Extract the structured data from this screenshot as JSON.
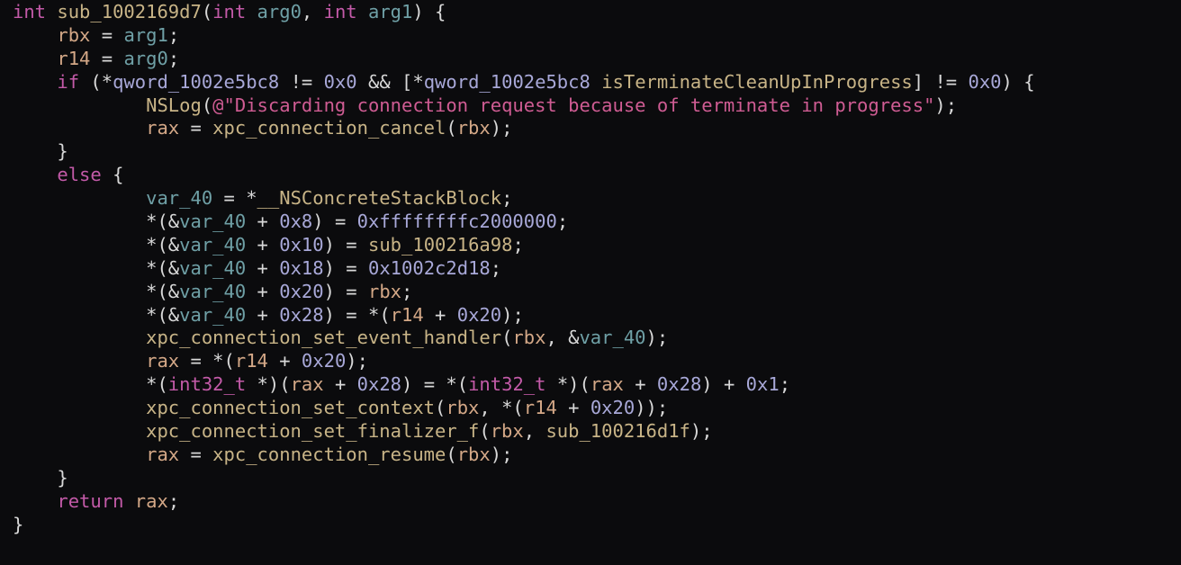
{
  "colors": {
    "background": "#0b0b0d",
    "keyword": "#c35aa8",
    "function": "#c8b487",
    "variable": "#6fa0a6",
    "register": "#d4a887",
    "number": "#a8a8d8",
    "string": "#cf5c93",
    "plain": "#d8d8d8"
  },
  "code_lines": [
    [
      [
        "keyword",
        "int"
      ],
      [
        "plain",
        " "
      ],
      [
        "function",
        "sub_1002169d7"
      ],
      [
        "plain",
        "("
      ],
      [
        "keyword",
        "int"
      ],
      [
        "plain",
        " "
      ],
      [
        "variable",
        "arg0"
      ],
      [
        "plain",
        ", "
      ],
      [
        "keyword",
        "int"
      ],
      [
        "plain",
        " "
      ],
      [
        "variable",
        "arg1"
      ],
      [
        "plain",
        ") {"
      ]
    ],
    [
      [
        "plain",
        "    "
      ],
      [
        "register",
        "rbx"
      ],
      [
        "plain",
        " = "
      ],
      [
        "variable",
        "arg1"
      ],
      [
        "plain",
        ";"
      ]
    ],
    [
      [
        "plain",
        "    "
      ],
      [
        "register",
        "r14"
      ],
      [
        "plain",
        " = "
      ],
      [
        "variable",
        "arg0"
      ],
      [
        "plain",
        ";"
      ]
    ],
    [
      [
        "plain",
        "    "
      ],
      [
        "keyword",
        "if"
      ],
      [
        "plain",
        " (*"
      ],
      [
        "number",
        "qword_1002e5bc8"
      ],
      [
        "plain",
        " != "
      ],
      [
        "number",
        "0x0"
      ],
      [
        "plain",
        " && [*"
      ],
      [
        "number",
        "qword_1002e5bc8"
      ],
      [
        "plain",
        " "
      ],
      [
        "function",
        "isTerminateCleanUpInProgress"
      ],
      [
        "plain",
        "] != "
      ],
      [
        "number",
        "0x0"
      ],
      [
        "plain",
        ") {"
      ]
    ],
    [
      [
        "plain",
        "            "
      ],
      [
        "function",
        "NSLog"
      ],
      [
        "plain",
        "("
      ],
      [
        "string",
        "@\"Discarding connection request because of terminate in progress\""
      ],
      [
        "plain",
        ");"
      ]
    ],
    [
      [
        "plain",
        "            "
      ],
      [
        "register",
        "rax"
      ],
      [
        "plain",
        " = "
      ],
      [
        "function",
        "xpc_connection_cancel"
      ],
      [
        "plain",
        "("
      ],
      [
        "register",
        "rbx"
      ],
      [
        "plain",
        ");"
      ]
    ],
    [
      [
        "plain",
        "    }"
      ]
    ],
    [
      [
        "plain",
        "    "
      ],
      [
        "keyword",
        "else"
      ],
      [
        "plain",
        " {"
      ]
    ],
    [
      [
        "plain",
        "            "
      ],
      [
        "variable",
        "var_40"
      ],
      [
        "plain",
        " = *"
      ],
      [
        "function",
        "__NSConcreteStackBlock"
      ],
      [
        "plain",
        ";"
      ]
    ],
    [
      [
        "plain",
        "            *(&"
      ],
      [
        "variable",
        "var_40"
      ],
      [
        "plain",
        " + "
      ],
      [
        "number",
        "0x8"
      ],
      [
        "plain",
        ") = "
      ],
      [
        "number",
        "0xffffffffc2000000"
      ],
      [
        "plain",
        ";"
      ]
    ],
    [
      [
        "plain",
        "            *(&"
      ],
      [
        "variable",
        "var_40"
      ],
      [
        "plain",
        " + "
      ],
      [
        "number",
        "0x10"
      ],
      [
        "plain",
        ") = "
      ],
      [
        "function",
        "sub_100216a98"
      ],
      [
        "plain",
        ";"
      ]
    ],
    [
      [
        "plain",
        "            *(&"
      ],
      [
        "variable",
        "var_40"
      ],
      [
        "plain",
        " + "
      ],
      [
        "number",
        "0x18"
      ],
      [
        "plain",
        ") = "
      ],
      [
        "number",
        "0x1002c2d18"
      ],
      [
        "plain",
        ";"
      ]
    ],
    [
      [
        "plain",
        "            *(&"
      ],
      [
        "variable",
        "var_40"
      ],
      [
        "plain",
        " + "
      ],
      [
        "number",
        "0x20"
      ],
      [
        "plain",
        ") = "
      ],
      [
        "register",
        "rbx"
      ],
      [
        "plain",
        ";"
      ]
    ],
    [
      [
        "plain",
        "            *(&"
      ],
      [
        "variable",
        "var_40"
      ],
      [
        "plain",
        " + "
      ],
      [
        "number",
        "0x28"
      ],
      [
        "plain",
        ") = *("
      ],
      [
        "register",
        "r14"
      ],
      [
        "plain",
        " + "
      ],
      [
        "number",
        "0x20"
      ],
      [
        "plain",
        ");"
      ]
    ],
    [
      [
        "plain",
        "            "
      ],
      [
        "function",
        "xpc_connection_set_event_handler"
      ],
      [
        "plain",
        "("
      ],
      [
        "register",
        "rbx"
      ],
      [
        "plain",
        ", &"
      ],
      [
        "variable",
        "var_40"
      ],
      [
        "plain",
        ");"
      ]
    ],
    [
      [
        "plain",
        "            "
      ],
      [
        "register",
        "rax"
      ],
      [
        "plain",
        " = *("
      ],
      [
        "register",
        "r14"
      ],
      [
        "plain",
        " + "
      ],
      [
        "number",
        "0x20"
      ],
      [
        "plain",
        ");"
      ]
    ],
    [
      [
        "plain",
        "            *("
      ],
      [
        "keyword",
        "int32_t"
      ],
      [
        "plain",
        " *)("
      ],
      [
        "register",
        "rax"
      ],
      [
        "plain",
        " + "
      ],
      [
        "number",
        "0x28"
      ],
      [
        "plain",
        ") = *("
      ],
      [
        "keyword",
        "int32_t"
      ],
      [
        "plain",
        " *)("
      ],
      [
        "register",
        "rax"
      ],
      [
        "plain",
        " + "
      ],
      [
        "number",
        "0x28"
      ],
      [
        "plain",
        ") + "
      ],
      [
        "number",
        "0x1"
      ],
      [
        "plain",
        ";"
      ]
    ],
    [
      [
        "plain",
        "            "
      ],
      [
        "function",
        "xpc_connection_set_context"
      ],
      [
        "plain",
        "("
      ],
      [
        "register",
        "rbx"
      ],
      [
        "plain",
        ", *("
      ],
      [
        "register",
        "r14"
      ],
      [
        "plain",
        " + "
      ],
      [
        "number",
        "0x20"
      ],
      [
        "plain",
        "));"
      ]
    ],
    [
      [
        "plain",
        "            "
      ],
      [
        "function",
        "xpc_connection_set_finalizer_f"
      ],
      [
        "plain",
        "("
      ],
      [
        "register",
        "rbx"
      ],
      [
        "plain",
        ", "
      ],
      [
        "function",
        "sub_100216d1f"
      ],
      [
        "plain",
        ");"
      ]
    ],
    [
      [
        "plain",
        "            "
      ],
      [
        "register",
        "rax"
      ],
      [
        "plain",
        " = "
      ],
      [
        "function",
        "xpc_connection_resume"
      ],
      [
        "plain",
        "("
      ],
      [
        "register",
        "rbx"
      ],
      [
        "plain",
        ");"
      ]
    ],
    [
      [
        "plain",
        "    }"
      ]
    ],
    [
      [
        "plain",
        "    "
      ],
      [
        "keyword",
        "return"
      ],
      [
        "plain",
        " "
      ],
      [
        "register",
        "rax"
      ],
      [
        "plain",
        ";"
      ]
    ],
    [
      [
        "plain",
        "}"
      ]
    ]
  ]
}
